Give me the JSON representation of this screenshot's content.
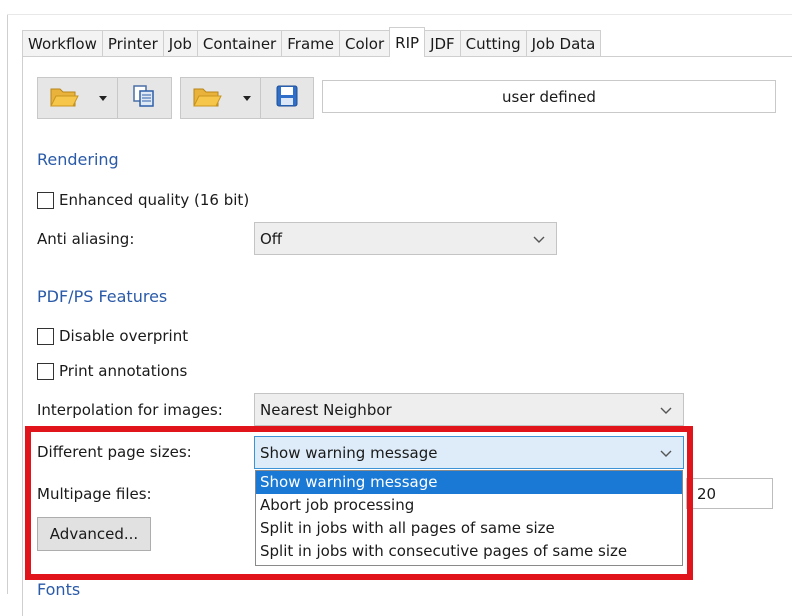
{
  "tabs": [
    {
      "label": "Workflow"
    },
    {
      "label": "Printer"
    },
    {
      "label": "Job"
    },
    {
      "label": "Container"
    },
    {
      "label": "Frame"
    },
    {
      "label": "Color"
    },
    {
      "label": "RIP",
      "active": true
    },
    {
      "label": "JDF"
    },
    {
      "label": "Cutting"
    },
    {
      "label": "Job Data"
    }
  ],
  "toolbar": {
    "profile_name": "user defined",
    "icons": [
      "folder-open-icon",
      "dropdown-arrow-icon",
      "copy-icon",
      "folder-open-icon",
      "dropdown-arrow-icon",
      "save-icon"
    ]
  },
  "rendering": {
    "heading": "Rendering",
    "enhanced_quality_label": "Enhanced quality (16 bit)",
    "enhanced_quality_checked": false,
    "anti_aliasing_label": "Anti aliasing:",
    "anti_aliasing_value": "Off"
  },
  "pdf_ps": {
    "heading": "PDF/PS Features",
    "disable_overprint_label": "Disable overprint",
    "disable_overprint_checked": false,
    "print_annotations_label": "Print annotations",
    "print_annotations_checked": false,
    "interpolation_label": "Interpolation for images:",
    "interpolation_value": "Nearest Neighbor",
    "page_sizes_label": "Different page sizes:",
    "page_sizes_value": "Show warning message",
    "page_sizes_options": [
      "Show warning message",
      "Abort job processing",
      "Split in jobs with all pages of same size",
      "Split in jobs with consecutive pages of same size"
    ],
    "multipage_label": "Multipage files:",
    "multipage_value": "20",
    "advanced_label": "Advanced..."
  },
  "fonts": {
    "heading": "Fonts"
  },
  "colors": {
    "heading": "#2a5aa8",
    "highlight": "#e0141a",
    "selection": "#1979d4"
  }
}
